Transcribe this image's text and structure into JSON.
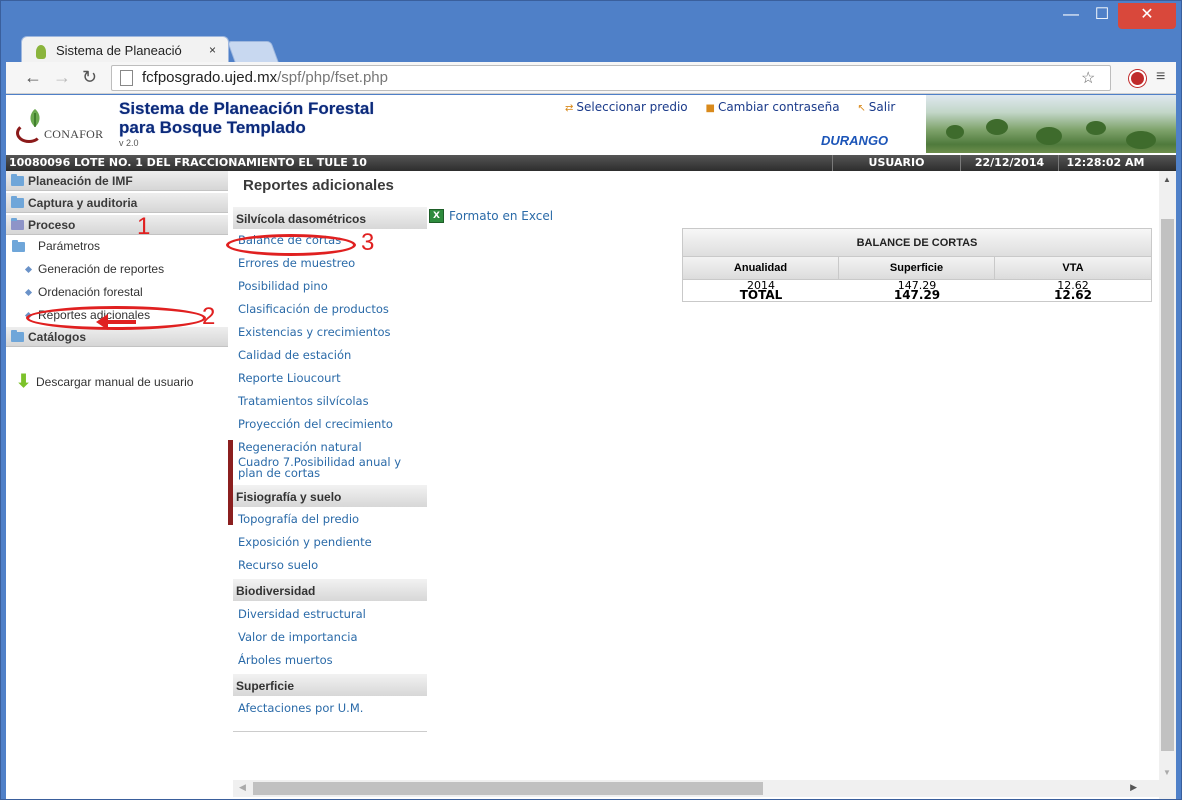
{
  "browser": {
    "tab_title": "Sistema de Planeació",
    "tab_close": "×",
    "url_host": "fcfposgrado.ujed.mx",
    "url_path": "/spf/php/fset.php",
    "win_min": "—",
    "win_max": "☐",
    "win_close": "✕"
  },
  "header": {
    "logo_text": "CONAFOR",
    "title_line1": "Sistema de Planeación Forestal",
    "title_line2": "para Bosque Templado",
    "version": "v 2.0",
    "links": [
      "Seleccionar predio",
      "Cambiar contraseña",
      "Salir"
    ],
    "state": "DURANGO"
  },
  "statusbar": {
    "lote": "10080096 LOTE NO. 1 DEL FRACCIONAMIENTO EL TULE 10",
    "user": "USUARIO",
    "date": "22/12/2014",
    "time": "12:28:02 AM"
  },
  "leftnav": {
    "sections": [
      "Planeación de IMF",
      "Captura y auditoria",
      "Proceso",
      "Catálogos"
    ],
    "subitems": [
      "Parámetros",
      "Generación de reportes",
      "Ordenación forestal",
      "Reportes adicionales"
    ],
    "download": "Descargar manual de usuario"
  },
  "content": {
    "title": "Reportes adicionales",
    "excel_link": "Formato en Excel",
    "sections": {
      "silvicola": "Silvícola dasométricos",
      "fisiografia": "Fisiografía y suelo",
      "biodiversidad": "Biodiversidad",
      "superficie": "Superficie"
    },
    "silvicola_items": [
      "Balance de cortas",
      "Errores de muestreo",
      "Posibilidad pino",
      "Clasificación de productos",
      "Existencias y crecimientos",
      "Calidad de estación",
      "Reporte Lioucourt",
      "Tratamientos silvícolas",
      "Proyección del crecimiento",
      "Regeneración natural",
      "Cuadro 7.Posibilidad anual y",
      "plan de cortas"
    ],
    "fisiografia_items": [
      "Topografía del predio",
      "Exposición y pendiente",
      "Recurso suelo"
    ],
    "biodiversidad_items": [
      "Diversidad estructural",
      "Valor de importancia",
      "Árboles muertos"
    ],
    "superficie_items": [
      "Afectaciones por U.M."
    ]
  },
  "balance_table": {
    "caption": "BALANCE DE CORTAS",
    "headers": [
      "Anualidad",
      "Superficie",
      "VTA"
    ],
    "rows": [
      [
        "2014",
        "147.29",
        "12.62"
      ]
    ],
    "total": [
      "TOTAL",
      "147.29",
      "12.62"
    ]
  },
  "annotations": {
    "num1": "1",
    "num2": "2",
    "num3": "3",
    "color": "#e02020"
  }
}
